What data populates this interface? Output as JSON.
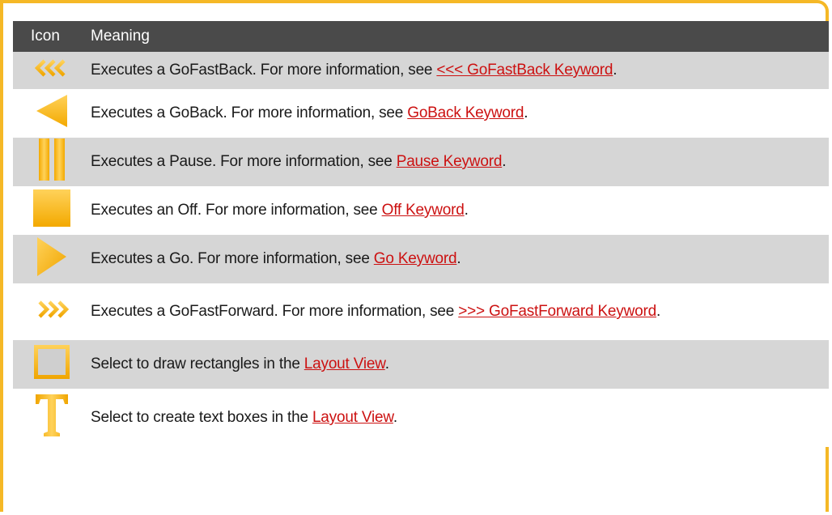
{
  "table": {
    "header": {
      "icon": "Icon",
      "meaning": "Meaning"
    },
    "rows": [
      {
        "icon": "go-fast-back-icon",
        "text": "Executes a GoFastBack. For more information, see ",
        "link": "<<< GoFastBack Keyword",
        "suffix": "."
      },
      {
        "icon": "go-back-icon",
        "text": "Executes a GoBack. For more information, see ",
        "link": "GoBack Keyword",
        "suffix": "."
      },
      {
        "icon": "pause-icon",
        "text": "Executes a Pause. For more information, see ",
        "link": "Pause Keyword",
        "suffix": "."
      },
      {
        "icon": "off-icon",
        "text": "Executes an Off. For more information, see ",
        "link": "Off Keyword",
        "suffix": "."
      },
      {
        "icon": "go-icon",
        "text": "Executes a Go. For more information, see ",
        "link": "Go Keyword",
        "suffix": "."
      },
      {
        "icon": "go-fast-forward-icon",
        "text": "Executes a GoFastForward. For more information, see ",
        "link": ">>> GoFastForward Keyword",
        "suffix": "."
      },
      {
        "icon": "rectangle-icon",
        "text": "Select to draw rectangles in the ",
        "link": "Layout View",
        "suffix": "."
      },
      {
        "icon": "text-box-icon",
        "text": "Select to create text boxes in the ",
        "link": "Layout View",
        "suffix": "."
      }
    ]
  },
  "colors": {
    "accent": "#f5b826",
    "header_bg": "#4a4a4a",
    "row_shade": "#d6d6d6",
    "link": "#cc1111"
  }
}
